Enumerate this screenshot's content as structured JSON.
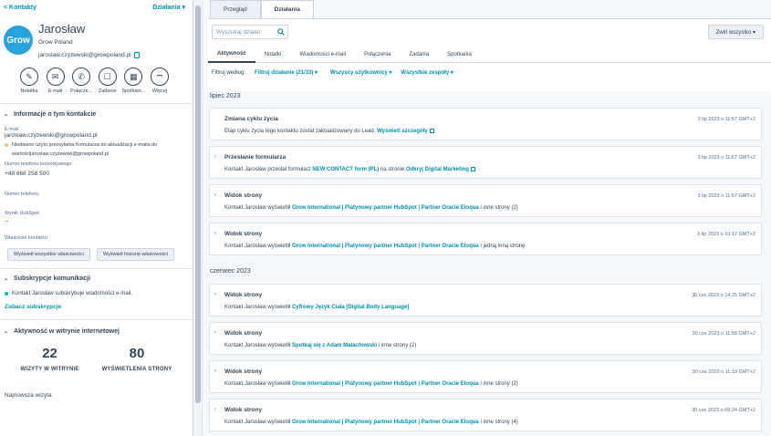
{
  "left": {
    "back_label": "< Kontakty",
    "actions_label": "Działania ▾",
    "logo_text": "Grow",
    "name": "Jarosław",
    "company": "Grow Poland",
    "email": "jaroslaw.czyzewski@growpoland.pl",
    "action_buttons": [
      {
        "label": "Notatka",
        "icon": "note-icon",
        "glyph": "✎"
      },
      {
        "label": "E-mail",
        "icon": "email-icon",
        "glyph": "✉"
      },
      {
        "label": "Połącze...",
        "icon": "phone-icon",
        "glyph": "✆"
      },
      {
        "label": "Zadanie",
        "icon": "task-icon",
        "glyph": "☐"
      },
      {
        "label": "Spotkani...",
        "icon": "calendar-icon",
        "glyph": "▦"
      },
      {
        "label": "Więcej",
        "icon": "more-icon",
        "glyph": "•••"
      }
    ],
    "about": {
      "heading": "Informacje o tym kontakcie",
      "email_label": "E-mail",
      "email_value": "jaroslaw.czyzewski@growpoland.pl",
      "notice": "Niedawno użyto przesyłania formularza do aktualizacji e-maila do wartościjaroslaw.czyzewski@growpoland.pl",
      "phone_label": "Numer telefonu komórkowego",
      "phone_value": "+48 668 258 500",
      "tel_label": "Numer telefonu",
      "score_label": "Wynik HubSpot",
      "score_value": "--",
      "owner_label": "Właściciel kontaktu",
      "btn_all": "Wyświetl wszystkie właściwości",
      "btn_history": "Wyświetl historię właściwości"
    },
    "subs": {
      "heading": "Subskrypcje komunikacji",
      "text": "Kontakt Jarosław subskrybuje wiadomości e-mail.",
      "link": "Zobacz subskrypcje"
    },
    "web": {
      "heading": "Aktywność w witrynie internetowej",
      "visits": "22",
      "visits_label": "WIZYTY W WITRYNIE",
      "views": "80",
      "views_label": "WYŚWIETLENIA STRONY",
      "latest_label": "Najnowsza wizyta"
    }
  },
  "main": {
    "tabs": [
      "Przegląd",
      "Działania"
    ],
    "search_placeholder": "Wyszukaj działar",
    "collapse_label": "Zwiń wszystko ▾",
    "subtabs": [
      "Aktywność",
      "Notatki",
      "Wiadomości e-mail",
      "Połączenia",
      "Zadania",
      "Spotkania"
    ],
    "filter_label": "Filtruj według:",
    "filter_activity": "Filtruj działanie (21/33) ▾",
    "filter_users": "Wszyscy użytkownicy ▾",
    "filter_teams": "Wszystkie zespoły ▾",
    "month1": "lipiec 2023",
    "month2": "czerwiec 2023",
    "cards": [
      {
        "title": "Zmiana cyklu życia",
        "pre": "Etap cyklu życia tego kontaktu został zaktualizowany do Lead.",
        "link": "Wyświetl szczegóły",
        "post": "",
        "date": "3 lip 2023 o 11:57 GMT+2",
        "chev": ""
      },
      {
        "title": "Przesłanie formularza",
        "pre": "Kontakt Jarosław przesłał formularz",
        "link": "NEW CONTACT form (PL)",
        "mid": "na stronie",
        "link2": "Odkryj Digital Marketing",
        "post": "",
        "date": "3 lip 2023 o 11:57 GMT+2",
        "chev": "›"
      },
      {
        "title": "Widok strony",
        "pre": "Kontakt Jarosław wyświetlił",
        "link": "Grow International | Platynowy partner HubSpot | Partner Oracle Eloqua",
        "post": "i inne strony (2)",
        "date": "3 lip 2023 o 11:57 GMT+2",
        "chev": "›"
      },
      {
        "title": "Widok strony",
        "pre": "Kontakt Jarosław wyświetlił",
        "link": "Grow International | Platynowy partner HubSpot | Partner Oracle Eloqua",
        "post": "i jedną inną stronę",
        "date": "3 lip 2023 o 10:12 GMT+2",
        "chev": "›"
      },
      {
        "title": "Widok strony",
        "pre": "Kontakt Jarosław wyświetlił",
        "link": "Cyfrowy Język Ciała [Digital Body Language]",
        "post": "",
        "date": "30 cze 2023 o 14:25 GMT+2",
        "chev": "›"
      },
      {
        "title": "Widok strony",
        "pre": "Kontakt Jarosław wyświetlił",
        "link": "Spotkaj się z Adam Małachowski",
        "post": "i inne strony (2)",
        "date": "30 cze 2023 o 11:58 GMT+2",
        "chev": "›"
      },
      {
        "title": "Widok strony",
        "pre": "Kontakt Jarosław wyświetlił",
        "link": "Grow International | Platynowy partner HubSpot | Partner Oracle Eloqua",
        "post": "i inne strony (2)",
        "date": "30 cze 2023 o 11:19 GMT+2",
        "chev": "›"
      },
      {
        "title": "Widok strony",
        "pre": "Kontakt Jarosław wyświetlił",
        "link": "Grow International | Platynowy partner HubSpot | Partner Oracle Eloqua",
        "post": "i inne strony (4)",
        "date": "30 cze 2023 o 09:24 GMT+2",
        "chev": "›"
      }
    ]
  },
  "colors": {
    "accent": "#0091ae",
    "text": "#33475b",
    "logo": "#28a3dc"
  }
}
